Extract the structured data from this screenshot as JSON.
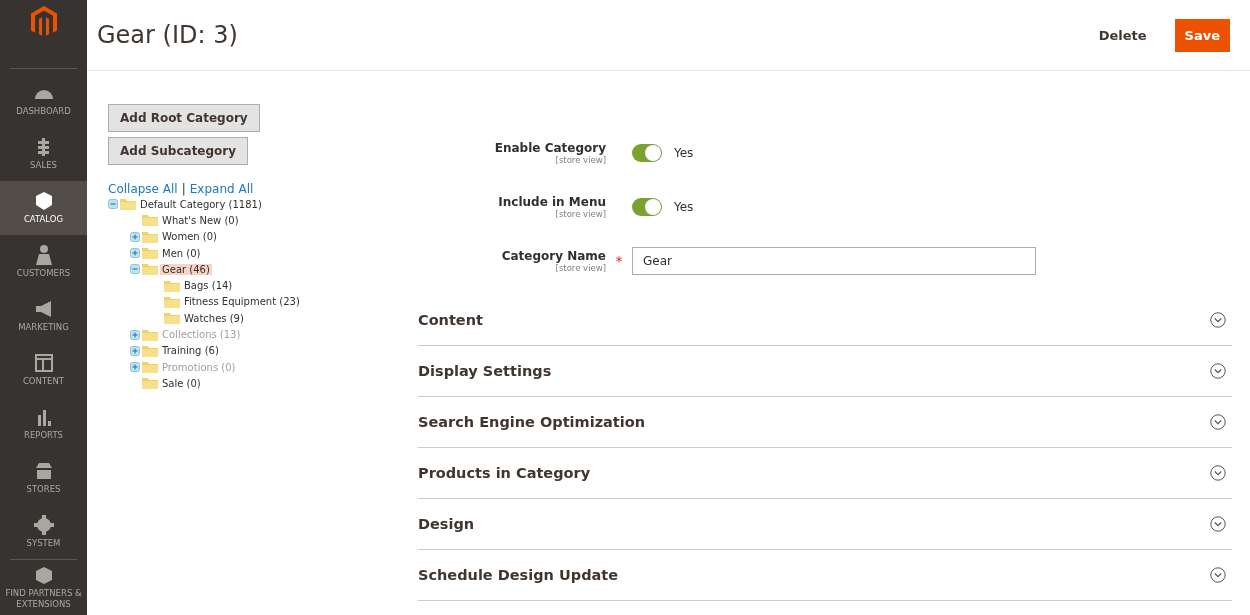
{
  "sidebar": {
    "items": [
      {
        "label": "DASHBOARD",
        "selected": false
      },
      {
        "label": "SALES",
        "selected": false
      },
      {
        "label": "CATALOG",
        "selected": true
      },
      {
        "label": "CUSTOMERS",
        "selected": false
      },
      {
        "label": "MARKETING",
        "selected": false
      },
      {
        "label": "CONTENT",
        "selected": false
      },
      {
        "label": "REPORTS",
        "selected": false
      },
      {
        "label": "STORES",
        "selected": false
      },
      {
        "label": "SYSTEM",
        "selected": false
      },
      {
        "label": "FIND PARTNERS & EXTENSIONS",
        "selected": false
      }
    ]
  },
  "header": {
    "title": "Gear (ID: 3)",
    "actions": [
      {
        "label": "Delete",
        "kind": "secondary"
      },
      {
        "label": "Save",
        "kind": "primary"
      }
    ]
  },
  "tree_buttons": [
    "Add Root Category",
    "Add Subcategory"
  ],
  "tree_links": [
    "Collapse All",
    "Expand All"
  ],
  "tree_link_separator": "|",
  "tree": [
    {
      "label": "Default Category (1181)",
      "has_children": true,
      "expanded": true,
      "disabled": false,
      "selected": false,
      "children": [
        {
          "label": "What's New (0)",
          "has_children": false,
          "disabled": false,
          "selected": false
        },
        {
          "label": "Women (0)",
          "has_children": true,
          "expanded": false,
          "disabled": false,
          "selected": false
        },
        {
          "label": "Men (0)",
          "has_children": true,
          "expanded": false,
          "disabled": false,
          "selected": false
        },
        {
          "label": "Gear (46)",
          "has_children": true,
          "expanded": true,
          "disabled": false,
          "selected": true,
          "children": [
            {
              "label": "Bags (14)",
              "has_children": false,
              "disabled": false,
              "selected": false
            },
            {
              "label": "Fitness Equipment (23)",
              "has_children": false,
              "disabled": false,
              "selected": false
            },
            {
              "label": "Watches (9)",
              "has_children": false,
              "disabled": false,
              "selected": false
            }
          ]
        },
        {
          "label": "Collections (13)",
          "has_children": true,
          "expanded": false,
          "disabled": true,
          "selected": false
        },
        {
          "label": "Training (6)",
          "has_children": true,
          "expanded": false,
          "disabled": false,
          "selected": false
        },
        {
          "label": "Promotions (0)",
          "has_children": true,
          "expanded": false,
          "disabled": true,
          "selected": false
        },
        {
          "label": "Sale (0)",
          "has_children": false,
          "disabled": false,
          "selected": false
        }
      ]
    }
  ],
  "form": {
    "fields": [
      {
        "kind": "toggle",
        "label": "Enable Category",
        "scope": "[store view]",
        "on": true,
        "value": "Yes"
      },
      {
        "kind": "toggle",
        "label": "Include in Menu",
        "scope": "[store view]",
        "on": true,
        "value": "Yes"
      },
      {
        "kind": "text",
        "label": "Category Name",
        "scope": "[store view]",
        "value": "Gear",
        "required_mark": "*"
      }
    ]
  },
  "sections": [
    {
      "title": "Content",
      "expanded": false
    },
    {
      "title": "Display Settings",
      "expanded": false
    },
    {
      "title": "Search Engine Optimization",
      "expanded": false
    },
    {
      "title": "Products in Category",
      "expanded": false
    },
    {
      "title": "Design",
      "expanded": false
    },
    {
      "title": "Schedule Design Update",
      "expanded": false
    }
  ]
}
